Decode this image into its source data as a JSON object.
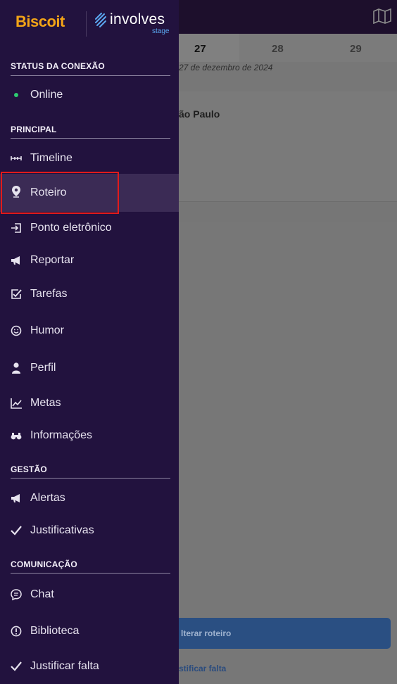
{
  "app": {
    "days": [
      "27",
      "28",
      "29"
    ],
    "date_text": "27 de dezembro de 2024",
    "location_title": "ão Paulo",
    "alterar_button": "lterar roteiro",
    "justificar_link": "stificar falta"
  },
  "drawer": {
    "brand": {
      "biscoit": "Biscoit",
      "involves": "involves",
      "stage": "stage"
    },
    "sections": {
      "status": "STATUS DA CONEXÃO",
      "principal": "PRINCIPAL",
      "gestao": "GESTÃO",
      "comunicacao": "COMUNICAÇÃO"
    },
    "status_item": {
      "label": "Online",
      "icon": "online-dot-icon"
    },
    "principal_items": [
      {
        "label": "Timeline",
        "icon": "timeline-icon"
      },
      {
        "label": "Roteiro",
        "icon": "map-pin-icon"
      },
      {
        "label": "Ponto eletrônico",
        "icon": "sign-in-icon"
      },
      {
        "label": "Reportar",
        "icon": "megaphone-icon"
      },
      {
        "label": "Tarefas",
        "icon": "checkbox-edit-icon"
      },
      {
        "label": "Humor",
        "icon": "smile-icon"
      },
      {
        "label": "Perfil",
        "icon": "user-icon"
      },
      {
        "label": "Metas",
        "icon": "chart-line-icon"
      },
      {
        "label": "Informações",
        "icon": "binoculars-icon"
      }
    ],
    "gestao_items": [
      {
        "label": "Alertas",
        "icon": "megaphone-icon"
      },
      {
        "label": "Justificativas",
        "icon": "check-icon"
      }
    ],
    "comunicacao_items": [
      {
        "label": "Chat",
        "icon": "chat-icon"
      },
      {
        "label": "Biblioteca",
        "icon": "info-circle-icon"
      },
      {
        "label": "Justificar falta",
        "icon": "check-icon"
      }
    ]
  },
  "colors": {
    "drawer_bg": "#22123e",
    "active_bg": "#3b2b55",
    "highlight_border": "#e21b1b",
    "online_dot": "#2ecc71",
    "biscoit_brand": "#f3a417",
    "stage_blue": "#5aa7f0"
  }
}
